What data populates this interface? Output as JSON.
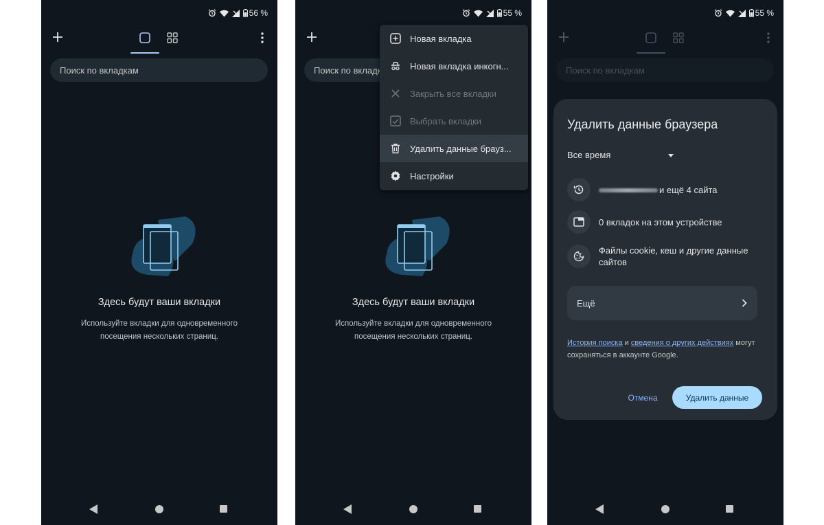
{
  "screens": [
    {
      "status": {
        "battery": "56 %"
      },
      "search_placeholder": "Поиск по вкладкам",
      "empty_title": "Здесь будут ваши вкладки",
      "empty_sub": "Используйте вкладки для одновременного посещения нескольких страниц."
    },
    {
      "status": {
        "battery": "55 %"
      },
      "search_placeholder": "Поиск по вкладкам",
      "empty_title": "Здесь будут ваши вкладки",
      "empty_sub": "Используйте вкладки для одновременного посещения нескольких страниц.",
      "menu": [
        {
          "label": "Новая вкладка",
          "icon": "add-box-icon",
          "enabled": true
        },
        {
          "label": "Новая вкладка инкогн...",
          "icon": "incognito-icon",
          "enabled": true
        },
        {
          "label": "Закрыть все вкладки",
          "icon": "close-icon",
          "enabled": false
        },
        {
          "label": "Выбрать вкладки",
          "icon": "checkbox-icon",
          "enabled": false
        },
        {
          "label": "Удалить данные брауз...",
          "icon": "trash-icon",
          "enabled": true,
          "highlighted": true
        },
        {
          "label": "Настройки",
          "icon": "gear-icon",
          "enabled": true
        }
      ]
    },
    {
      "status": {
        "battery": "55 %"
      },
      "search_placeholder": "Поиск по вкладкам",
      "dialog": {
        "title": "Удалить данные браузера",
        "time_range": "Все время",
        "history_suffix": "и ещё 4 сайта",
        "tabs_text": "0 вкладок на этом устройстве",
        "cookies_text": "Файлы cookie, кеш и другие данные сайтов",
        "more_label": "Ещё",
        "note_link1": "История поиска",
        "note_and": " и ",
        "note_link2": "сведения о других действиях",
        "note_rest": " могут сохраняться в аккаунте Google.",
        "cancel_label": "Отмена",
        "delete_label": "Удалить данные"
      }
    }
  ],
  "colors": {
    "background": "#0f161d",
    "accent": "#a8c7fa",
    "primary_button": "#a8dbff",
    "link": "#8ab4f8"
  }
}
